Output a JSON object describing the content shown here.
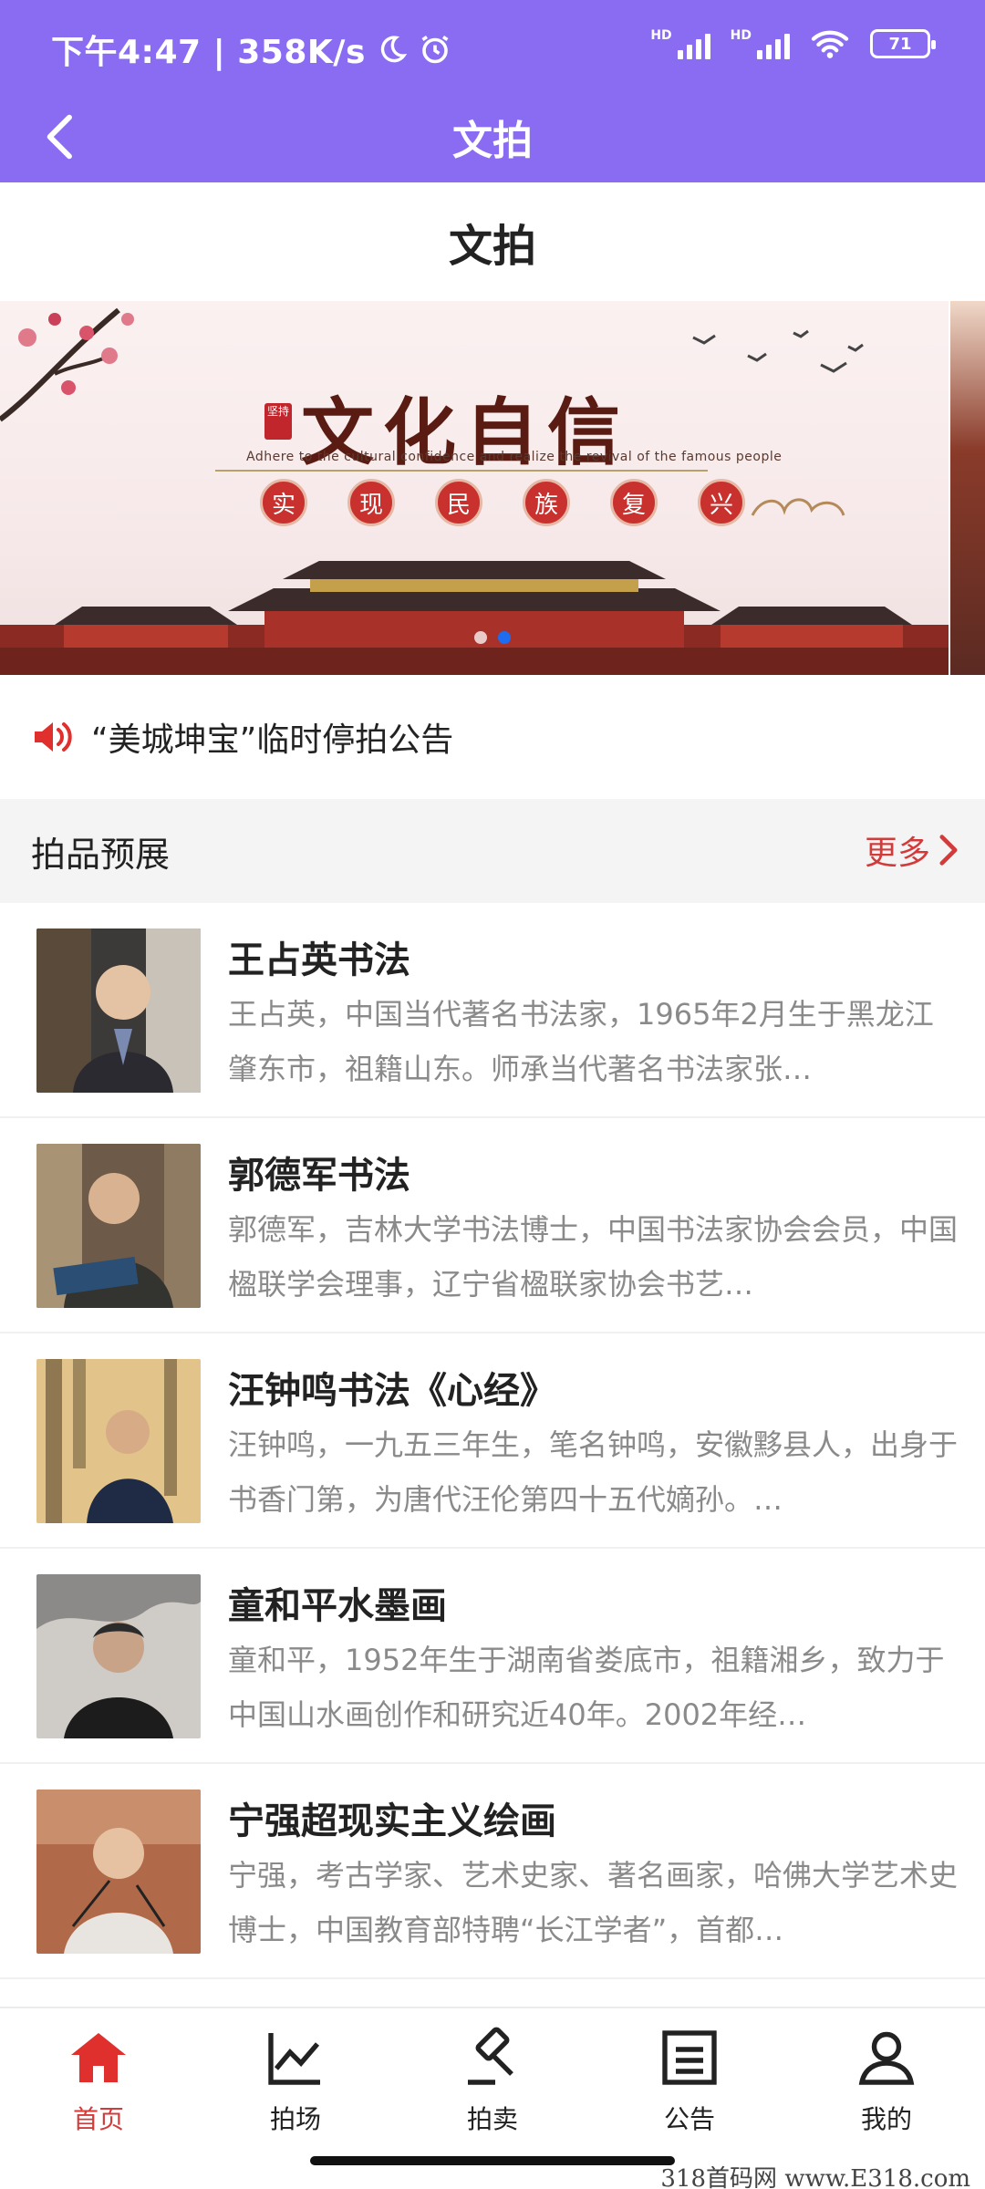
{
  "status_bar": {
    "time_speed": "下午4:47 | 358K/s",
    "signal_label_1": "HD",
    "signal_label_2": "HD",
    "battery": "71"
  },
  "app_bar": {
    "title": "文拍"
  },
  "page": {
    "heading": "文拍"
  },
  "banner": {
    "title": "文化自信",
    "seal": "坚持",
    "subtitle": "Adhere to the cultural confidence and realize the revival of the famous people",
    "chars": [
      "实",
      "现",
      "民",
      "族",
      "复",
      "兴"
    ],
    "active_slide": 2,
    "slide_count": 2
  },
  "notice": {
    "text": "“美城坤宝”临时停拍公告"
  },
  "section": {
    "title": "拍品预展",
    "more": "更多"
  },
  "items": [
    {
      "title": "王占英书法",
      "desc": "王占英，中国当代著名书法家，1965年2月生于黑龙江肇东市，祖籍山东。师承当代著名书法家张…"
    },
    {
      "title": "郭德军书法",
      "desc": "郭德军，吉林大学书法博士，中国书法家协会会员，中国楹联学会理事，辽宁省楹联家协会书艺…"
    },
    {
      "title": "汪钟鸣书法《心经》",
      "desc": "汪钟鸣，一九五三年生，笔名钟鸣，安徽黟县人，出身于书香门第，为唐代汪伦第四十五代嫡孙。…"
    },
    {
      "title": "童和平水墨画",
      "desc": "童和平，1952年生于湖南省娄底市，祖籍湘乡，致力于中国山水画创作和研究近40年。2002年经…"
    },
    {
      "title": "宁强超现实主义绘画",
      "desc": "宁强，考古学家、艺术史家、著名画家，哈佛大学艺术史博士，中国教育部特聘“长江学者”，首都…"
    }
  ],
  "bottom_nav": [
    {
      "label": "首页",
      "icon": "home-icon",
      "active": true
    },
    {
      "label": "拍场",
      "icon": "chart-icon",
      "active": false
    },
    {
      "label": "拍卖",
      "icon": "gavel-icon",
      "active": false
    },
    {
      "label": "公告",
      "icon": "notice-icon",
      "active": false
    },
    {
      "label": "我的",
      "icon": "user-icon",
      "active": false
    }
  ],
  "watermark": "318首码网 www.E318.com",
  "colors": {
    "accent": "#8a6cf3",
    "active_red": "#d33b3b",
    "dot_active": "#1e6df0"
  }
}
